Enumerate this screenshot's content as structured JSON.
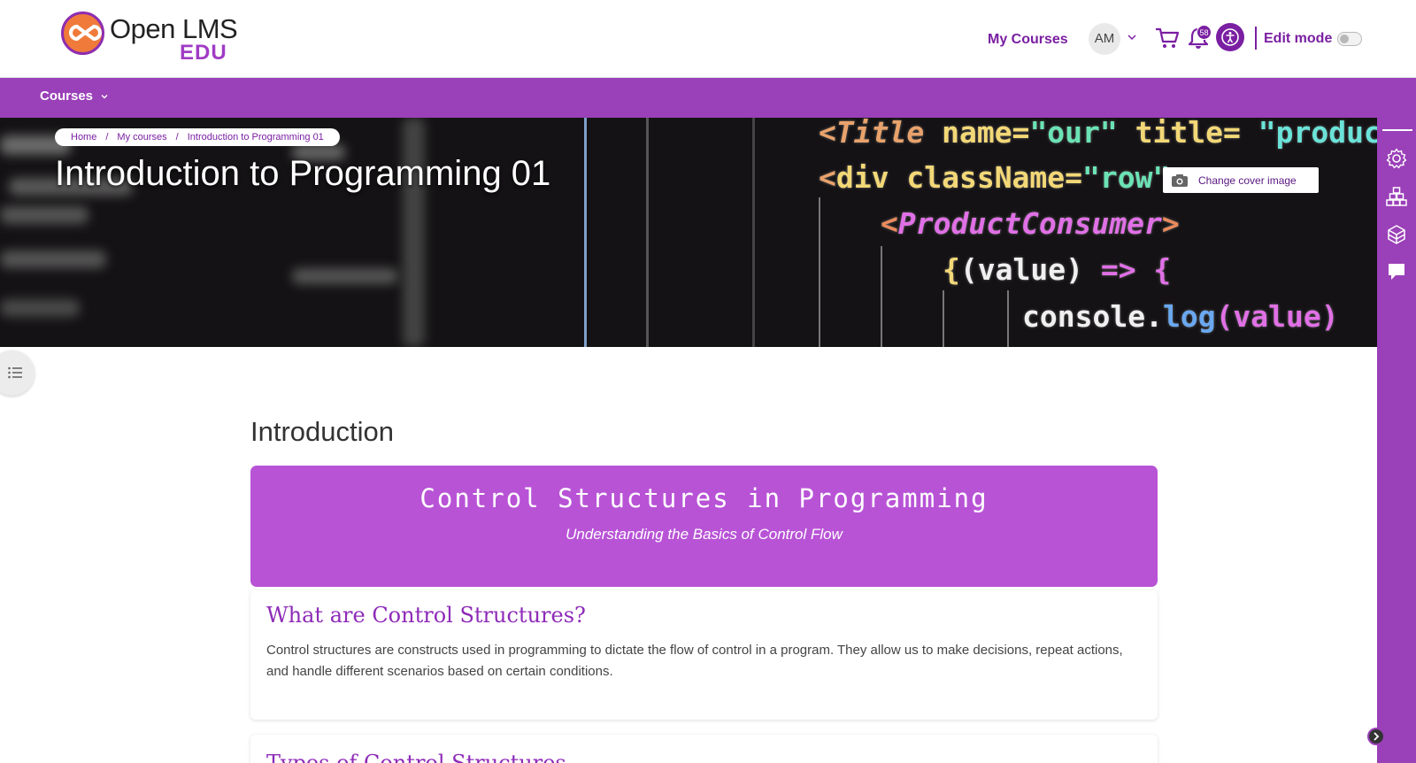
{
  "brand": {
    "name": "Open LMS",
    "sub": "EDU",
    "colors": {
      "primary": "#9a40b8",
      "accent": "#7a1fa2",
      "logo_orange": "#f07a3a"
    }
  },
  "header": {
    "my_courses": "My Courses",
    "avatar_initials": "AM",
    "notifications_count": "58",
    "edit_mode_label": "Edit mode",
    "edit_mode_on": false,
    "icons": [
      "chevron-down-icon",
      "cart-icon",
      "bell-icon",
      "accessibility-icon"
    ]
  },
  "nav": {
    "courses": "Courses"
  },
  "hero": {
    "breadcrumb": [
      "Home",
      "My courses",
      "Introduction to Programming 01"
    ],
    "title": "Introduction to Programming 01",
    "change_cover": "Change cover image",
    "code_lines": [
      {
        "a": "<",
        "b": "Title",
        "c": " name=",
        "d": "\"our\"",
        "e": " title=",
        "f": " \"product"
      },
      {
        "a": "<",
        "b": "div",
        "c": " className=",
        "d": "\"row\"",
        "e": ">"
      },
      {
        "a": "<",
        "b": "ProductConsumer",
        "c": ">"
      },
      {
        "a": "{",
        "b": "(value)",
        "c": " => {"
      },
      {
        "a": "console.",
        "b": "log",
        "c": "(value)"
      }
    ]
  },
  "content": {
    "section_title": "Introduction",
    "banner_title": "Control Structures in Programming",
    "banner_subtitle": "Understanding the Basics of Control Flow",
    "card1_title": "What are Control Structures?",
    "card1_text": "Control structures are constructs used in programming to dictate the flow of control in a program. They allow us to make decisions, repeat actions, and handle different scenarios based on certain conditions.",
    "card2_title": "Types of Control Structures"
  },
  "right_drawer": {
    "icons": [
      "gear-icon",
      "blocks-icon",
      "tools-icon",
      "chat-icon"
    ]
  }
}
